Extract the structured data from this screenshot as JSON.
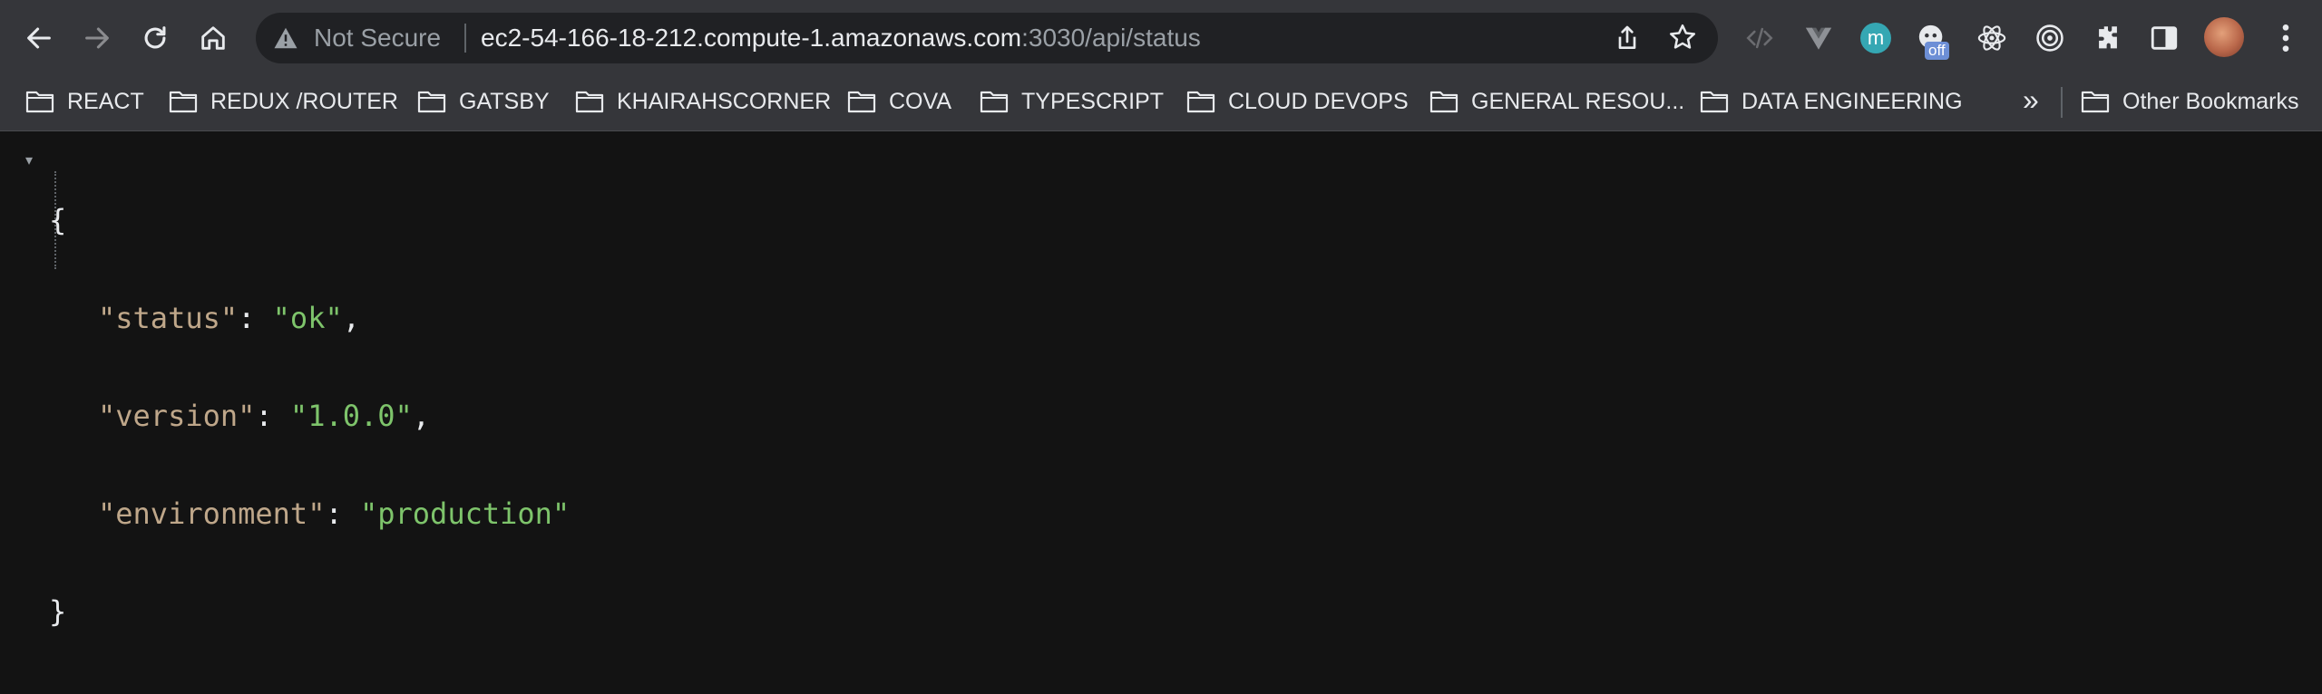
{
  "omnibox": {
    "security_label": "Not Secure",
    "url_host": "ec2-54-166-18-212.compute-1.amazonaws.com",
    "url_path": ":3030/api/status"
  },
  "extensions": {
    "m_letter": "m",
    "off_badge": "off"
  },
  "bookmarks": [
    {
      "label": "REACT"
    },
    {
      "label": "REDUX /ROUTER"
    },
    {
      "label": "GATSBY"
    },
    {
      "label": "KHAIRAHSCORNER"
    },
    {
      "label": "COVA"
    },
    {
      "label": "TYPESCRIPT"
    },
    {
      "label": "CLOUD DEVOPS"
    },
    {
      "label": "GENERAL RESOU..."
    },
    {
      "label": "DATA ENGINEERING"
    }
  ],
  "bookmarks_more": "»",
  "other_bookmarks": "Other Bookmarks",
  "json_view": {
    "open_brace": "{",
    "close_brace": "}",
    "lines": [
      {
        "key": "status",
        "value": "ok",
        "trailing": ","
      },
      {
        "key": "version",
        "value": "1.0.0",
        "trailing": ","
      },
      {
        "key": "environment",
        "value": "production",
        "trailing": ""
      }
    ]
  },
  "colors": {
    "toolbar_bg": "#35363a",
    "page_bg": "#131313",
    "json_key": "#bfa78a",
    "json_string": "#7ec46b"
  }
}
